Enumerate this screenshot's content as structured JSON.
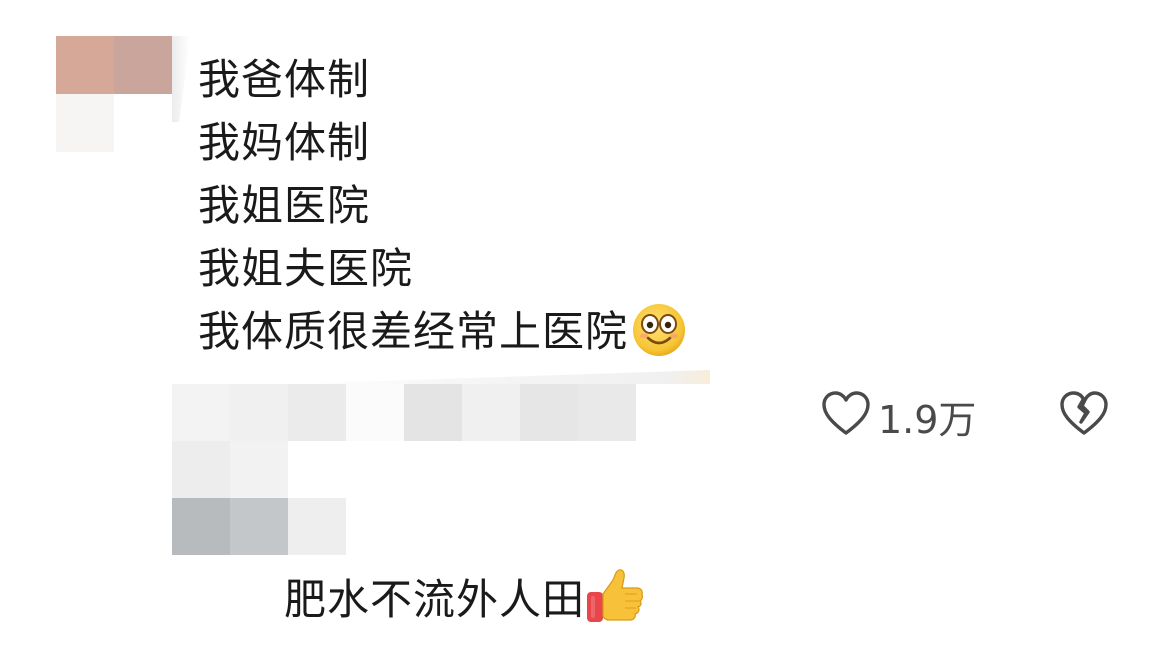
{
  "comment": {
    "lines": [
      "我爸体制",
      "我妈体制",
      "我姐医院",
      "我姐夫医院",
      "我体质很差经常上医院"
    ],
    "trailing_emoji": "smile-emoji"
  },
  "actions": {
    "like_icon": "heart-outline-icon",
    "like_count": "1.9万",
    "dislike_icon": "broken-heart-icon"
  },
  "reply": {
    "text": "肥水不流外人田",
    "trailing_emoji": "thumbs-up-emoji"
  },
  "colors": {
    "text": "#1a1a1a",
    "muted": "#4a4a4a",
    "emoji_yellow": "#f7c534",
    "thumb_sleeve": "#e8464a"
  }
}
